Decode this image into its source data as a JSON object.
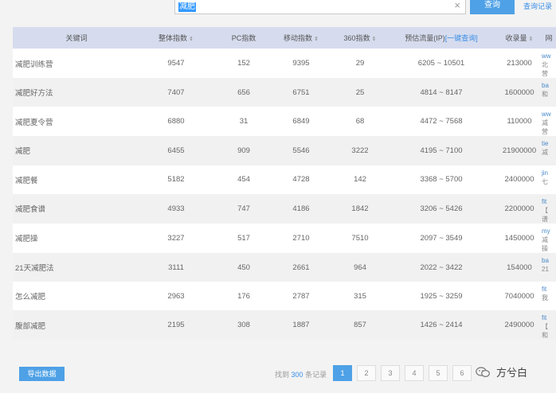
{
  "search": {
    "value": "减肥",
    "clear_glyph": "×",
    "button_label": "查询",
    "history_label": "查询记录"
  },
  "table": {
    "headers": [
      "关键词",
      "整体指数",
      "PC指数",
      "移动指数",
      "360指数",
      "预估流量(IP)",
      "收录量",
      "网"
    ],
    "estimate_link": "[一键查询]",
    "sort_glyph": "⇕",
    "rows": [
      {
        "keyword": "减肥训练营",
        "overall": "9547",
        "pc": "152",
        "mobile": "9395",
        "s360": "29",
        "traffic": "6205 ~ 10501",
        "indexed": "213000",
        "side_top": "ww",
        "side_sub": "北\n营"
      },
      {
        "keyword": "减肥好方法",
        "overall": "7407",
        "pc": "656",
        "mobile": "6751",
        "s360": "25",
        "traffic": "4814 ~ 8147",
        "indexed": "1600000",
        "side_top": "ba",
        "side_sub": "和"
      },
      {
        "keyword": "减肥夏令营",
        "overall": "6880",
        "pc": "31",
        "mobile": "6849",
        "s360": "68",
        "traffic": "4472 ~ 7568",
        "indexed": "110000",
        "side_top": "ww",
        "side_sub": "减\n营"
      },
      {
        "keyword": "减肥",
        "overall": "6455",
        "pc": "909",
        "mobile": "5546",
        "s360": "3222",
        "traffic": "4195 ~ 7100",
        "indexed": "21900000",
        "side_top": "tie",
        "side_sub": "减"
      },
      {
        "keyword": "减肥餐",
        "overall": "5182",
        "pc": "454",
        "mobile": "4728",
        "s360": "142",
        "traffic": "3368 ~ 5700",
        "indexed": "2400000",
        "side_top": "jin",
        "side_sub": "七"
      },
      {
        "keyword": "减肥食谱",
        "overall": "4933",
        "pc": "747",
        "mobile": "4186",
        "s360": "1842",
        "traffic": "3206 ~ 5426",
        "indexed": "2200000",
        "side_top": "fit",
        "side_sub": "【\n谱"
      },
      {
        "keyword": "减肥操",
        "overall": "3227",
        "pc": "517",
        "mobile": "2710",
        "s360": "7510",
        "traffic": "2097 ~ 3549",
        "indexed": "1450000",
        "side_top": "my",
        "side_sub": "减\n操"
      },
      {
        "keyword": "21天减肥法",
        "overall": "3111",
        "pc": "450",
        "mobile": "2661",
        "s360": "964",
        "traffic": "2022 ~ 3422",
        "indexed": "154000",
        "side_top": "ba",
        "side_sub": "21"
      },
      {
        "keyword": "怎么减肥",
        "overall": "2963",
        "pc": "176",
        "mobile": "2787",
        "s360": "315",
        "traffic": "1925 ~ 3259",
        "indexed": "7040000",
        "side_top": "fit",
        "side_sub": "我"
      },
      {
        "keyword": "腹部减肥",
        "overall": "2195",
        "pc": "308",
        "mobile": "1887",
        "s360": "857",
        "traffic": "1426 ~ 2414",
        "indexed": "2490000",
        "side_top": "fit",
        "side_sub": "【\n和"
      }
    ]
  },
  "footer": {
    "export_label": "导出数据",
    "total_prefix": "找到",
    "total_count": "300",
    "total_suffix": "条记录",
    "pages": [
      "1",
      "2",
      "3",
      "4",
      "5",
      "6"
    ],
    "active_page": "1",
    "watermark": "方兮白"
  },
  "colors": {
    "accent": "#4ea1e6",
    "header_bg": "#d6dcee",
    "link": "#3a8ee6"
  }
}
